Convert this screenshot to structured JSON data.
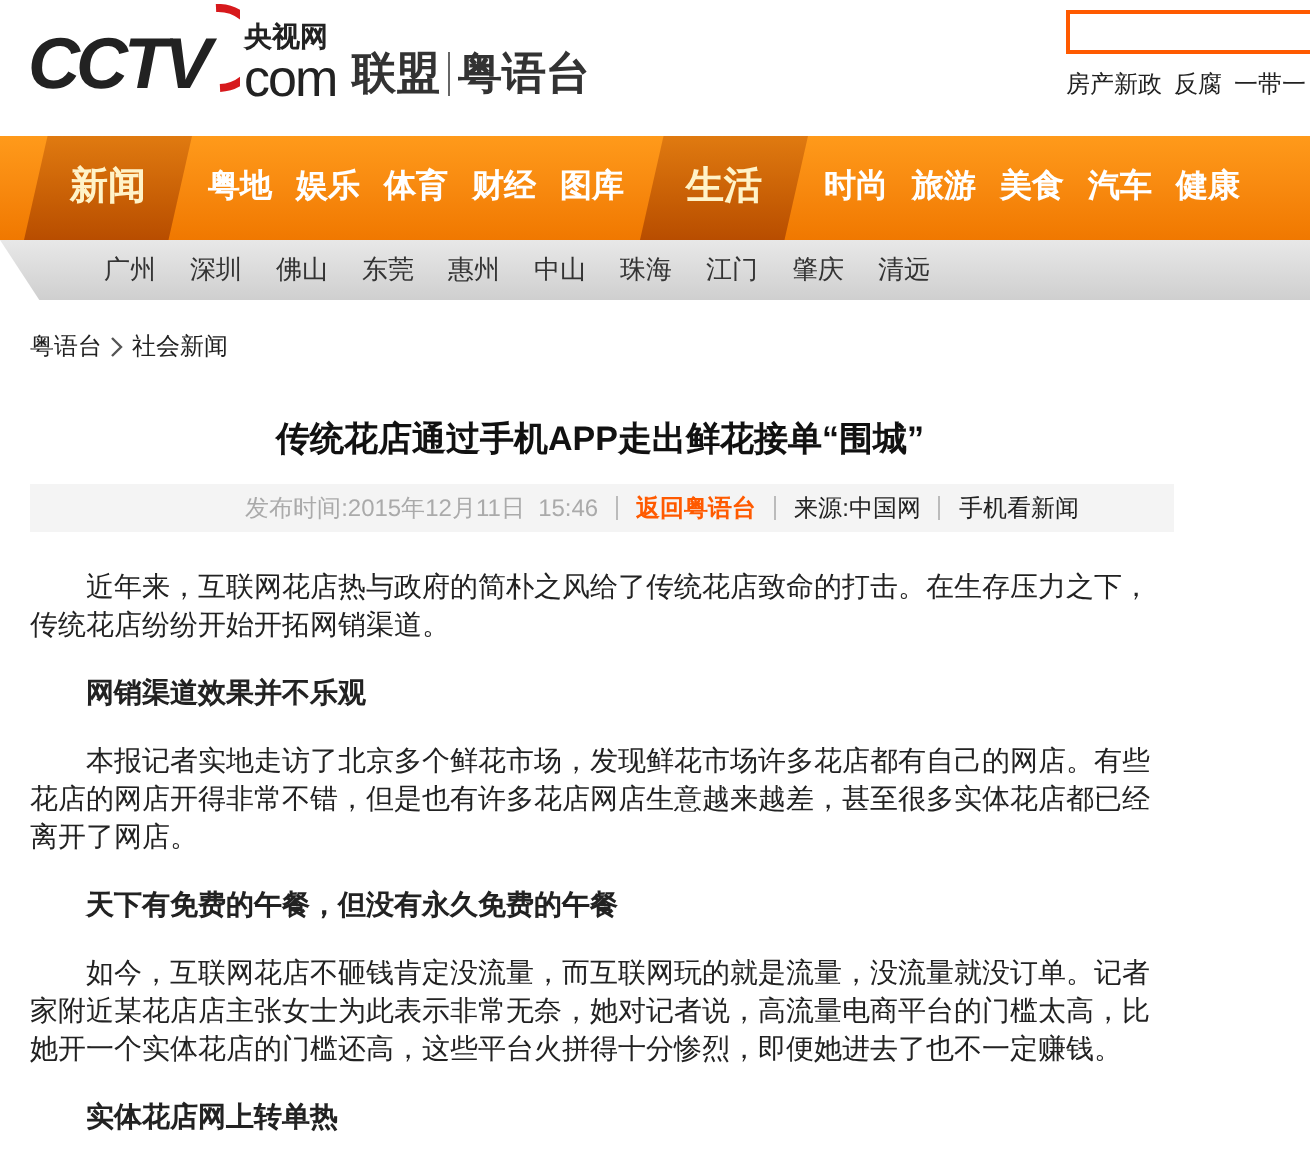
{
  "header": {
    "logo": {
      "mark": "CCTV",
      "cn": "央视网",
      "domain": "com"
    },
    "alliance": "联盟",
    "channel": "粤语台",
    "hot_links": [
      "房产新政",
      "反腐",
      "一带一"
    ]
  },
  "nav": [
    {
      "label": "新闻",
      "kind": "section"
    },
    {
      "label": "粤地",
      "kind": "link"
    },
    {
      "label": "娱乐",
      "kind": "link"
    },
    {
      "label": "体育",
      "kind": "link"
    },
    {
      "label": "财经",
      "kind": "link"
    },
    {
      "label": "图库",
      "kind": "link"
    },
    {
      "label": "生活",
      "kind": "section"
    },
    {
      "label": "时尚",
      "kind": "link"
    },
    {
      "label": "旅游",
      "kind": "link"
    },
    {
      "label": "美食",
      "kind": "link"
    },
    {
      "label": "汽车",
      "kind": "link"
    },
    {
      "label": "健康",
      "kind": "link"
    }
  ],
  "sub_nav": [
    "广州",
    "深圳",
    "佛山",
    "东莞",
    "惠州",
    "中山",
    "珠海",
    "江门",
    "肇庆",
    "清远"
  ],
  "breadcrumb": [
    "粤语台",
    "社会新闻"
  ],
  "article": {
    "title": "传统花店通过手机APP走出鲜花接单“围城”",
    "meta": {
      "published": "发布时间:2015年12月11日  15:46",
      "back_link": "返回粤语台",
      "source": "来源:中国网",
      "mobile": "手机看新闻"
    },
    "body": [
      {
        "kind": "paragraph",
        "text": "近年来，互联网花店热与政府的简朴之风给了传统花店致命的打击。在生存压力之下，传统花店纷纷开始开拓网销渠道。"
      },
      {
        "kind": "heading",
        "text": "网销渠道效果并不乐观"
      },
      {
        "kind": "paragraph",
        "text": "本报记者实地走访了北京多个鲜花市场，发现鲜花市场许多花店都有自己的网店。有些花店的网店开得非常不错，但是也有许多花店网店生意越来越差，甚至很多实体花店都已经离开了网店。"
      },
      {
        "kind": "heading",
        "text": "天下有免费的午餐，但没有永久免费的午餐"
      },
      {
        "kind": "paragraph",
        "text": "如今，互联网花店不砸钱肯定没流量，而互联网玩的就是流量，没流量就没订单。记者家附近某花店店主张女士为此表示非常无奈，她对记者说，高流量电商平台的门槛太高，比她开一个实体花店的门槛还高，这些平台火拼得十分惨烈，即便她进去了也不一定赚钱。"
      },
      {
        "kind": "heading",
        "text": "实体花店网上转单热"
      }
    ]
  }
}
